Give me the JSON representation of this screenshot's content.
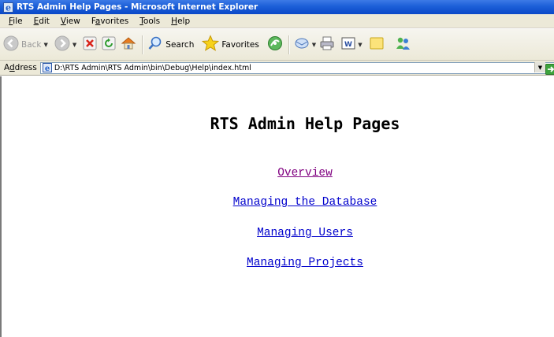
{
  "window": {
    "title": "RTS Admin Help Pages - Microsoft Internet Explorer"
  },
  "menu": [
    {
      "label": "File",
      "accel": "F",
      "rest": "ile"
    },
    {
      "label": "Edit",
      "accel": "E",
      "rest": "dit"
    },
    {
      "label": "View",
      "accel": "V",
      "rest": "iew"
    },
    {
      "label": "Favorites",
      "pre": "F",
      "accel": "a",
      "rest": "vorites"
    },
    {
      "label": "Tools",
      "accel": "T",
      "rest": "ools"
    },
    {
      "label": "Help",
      "accel": "H",
      "rest": "elp"
    }
  ],
  "toolbar": {
    "back_label": "Back",
    "search_label": "Search",
    "favorites_label": "Favorites"
  },
  "address": {
    "label_pre": "A",
    "label_accel": "d",
    "label_rest": "dress",
    "url": "D:\\RTS Admin\\RTS Admin\\bin\\Debug\\Help\\index.html"
  },
  "page": {
    "title": "RTS Admin Help Pages",
    "links": [
      {
        "label": "Overview",
        "visited": true
      },
      {
        "label": "Managing the Database",
        "visited": false
      },
      {
        "label": "Managing Users",
        "visited": false
      },
      {
        "label": "Managing Projects",
        "visited": false
      }
    ]
  },
  "colors": {
    "titlebar": "#0a48c8",
    "link": "#0000cc",
    "visited_link": "#800080",
    "chrome": "#ece9d8"
  }
}
